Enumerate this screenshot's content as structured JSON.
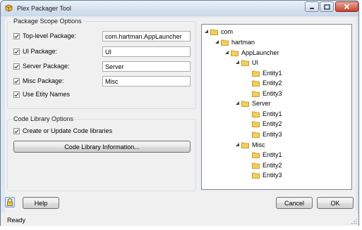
{
  "window": {
    "title": "Plex Packager Tool",
    "status": "Ready"
  },
  "package_scope": {
    "legend": "Package Scope Options",
    "top_level": {
      "label": "Top-level Package:",
      "checked": true,
      "value": "com.hartman.AppLauncher"
    },
    "ui": {
      "label": "UI Package:",
      "checked": true,
      "value": "UI"
    },
    "server": {
      "label": "Server Package:",
      "checked": true,
      "value": "Server"
    },
    "misc": {
      "label": "Misc Package:",
      "checked": true,
      "value": "Misc"
    },
    "entity_names": {
      "label": "Use Etity Names",
      "checked": true
    }
  },
  "code_library": {
    "legend": "Code Library Options",
    "create_update": {
      "label": "Create or Update Code libraries",
      "checked": true
    },
    "info_button": "Code Library Information..."
  },
  "buttons": {
    "help": "Help",
    "cancel": "Cancel",
    "ok": "OK"
  },
  "tree": {
    "nodes": [
      "com",
      "hartman",
      "AppLauncher",
      "UI",
      "Entity1",
      "Entity2",
      "Entity3",
      "Server",
      "Entity1",
      "Entity2",
      "Entity3",
      "Misc",
      "Entity1",
      "Entity2",
      "Entity3"
    ]
  },
  "icons": {
    "app": "package-icon",
    "folder": "folder-icon",
    "expander": "expanded-triangle-icon",
    "lock": "lock-icon"
  }
}
